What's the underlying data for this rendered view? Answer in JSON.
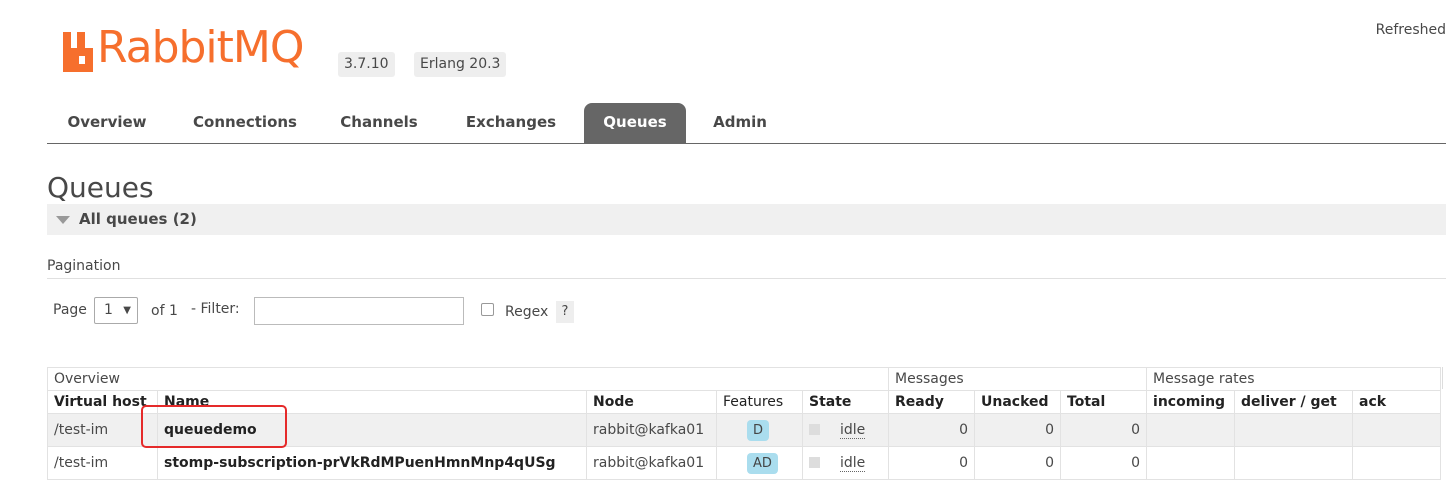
{
  "header": {
    "logo_text": "RabbitMQ",
    "version": "3.7.10",
    "erlang": "Erlang 20.3",
    "refreshed": "Refreshed",
    "brand_color": "#f66f2d"
  },
  "tabs": [
    {
      "label": "Overview"
    },
    {
      "label": "Connections"
    },
    {
      "label": "Channels"
    },
    {
      "label": "Exchanges"
    },
    {
      "label": "Queues",
      "active": true
    },
    {
      "label": "Admin"
    }
  ],
  "page_title": "Queues",
  "section": {
    "label": "All queues (2)"
  },
  "pagination": {
    "label": "Pagination",
    "page_word": "Page",
    "page_value": "1",
    "of_text": "of 1",
    "filter_label": "- Filter:",
    "filter_value": "",
    "regex_label": "Regex",
    "regex_checked": false,
    "help": "?"
  },
  "table": {
    "groups": {
      "overview": "Overview",
      "messages": "Messages",
      "rates": "Message rates"
    },
    "columns": {
      "vhost": "Virtual host",
      "name": "Name",
      "node": "Node",
      "features": "Features",
      "state": "State",
      "ready": "Ready",
      "unacked": "Unacked",
      "total": "Total",
      "incoming": "incoming",
      "deliver": "deliver / get",
      "ack": "ack"
    },
    "rows": [
      {
        "vhost": "/test-im",
        "name": "queuedemo",
        "node": "rabbit@kafka01",
        "features": "D",
        "state": "idle",
        "ready": "0",
        "unacked": "0",
        "total": "0"
      },
      {
        "vhost": "/test-im",
        "name": "stomp-subscription-prVkRdMPuenHmnMnp4qUSg",
        "node": "rabbit@kafka01",
        "features": "AD",
        "state": "idle",
        "ready": "0",
        "unacked": "0",
        "total": "0"
      }
    ]
  },
  "highlight_color": "#e52a2a"
}
